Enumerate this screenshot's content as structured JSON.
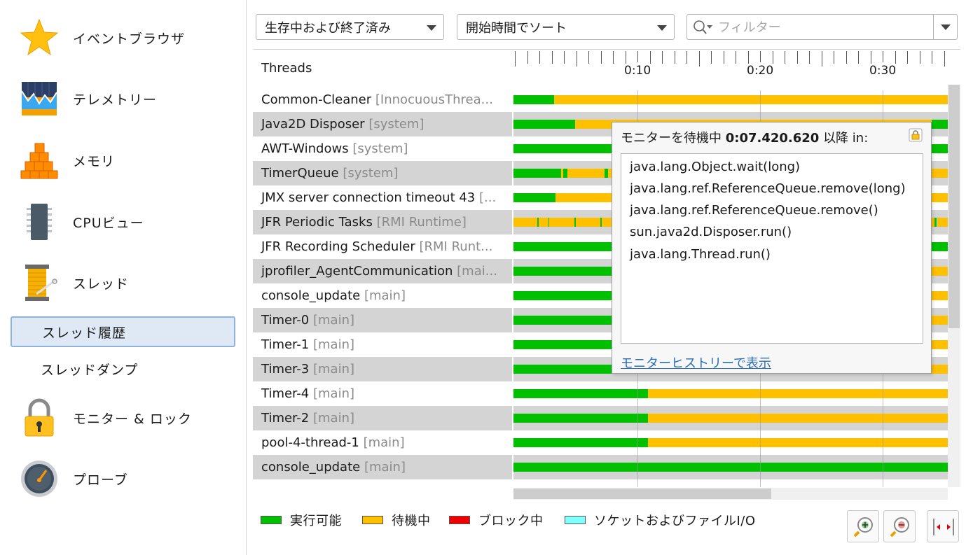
{
  "sidebar": {
    "items": [
      {
        "label": "イベントブラウザ",
        "icon": "star-icon"
      },
      {
        "label": "テレメトリー",
        "icon": "telemetry-icon"
      },
      {
        "label": "メモリ",
        "icon": "memory-blocks-icon"
      },
      {
        "label": "CPUビュー",
        "icon": "cpu-chip-icon"
      },
      {
        "label": "スレッド",
        "icon": "thread-spool-icon"
      },
      {
        "label": "モニター & ロック",
        "icon": "padlock-icon"
      },
      {
        "label": "プローブ",
        "icon": "gauge-icon"
      }
    ],
    "subitems": [
      {
        "label": "スレッド履歴",
        "selected": true
      },
      {
        "label": "スレッドダンプ",
        "selected": false
      }
    ]
  },
  "toolbar": {
    "state_filter": "生存中および終了済み",
    "sort": "開始時間でソート",
    "filter_placeholder": "フィルター"
  },
  "threads": {
    "header": "Threads",
    "time_labels": [
      "0:10",
      "0:20",
      "0:30"
    ],
    "rows": [
      {
        "name": "Common-Cleaner",
        "group": "[InnocuousThrea..."
      },
      {
        "name": "Java2D Disposer",
        "group": "[system]"
      },
      {
        "name": "AWT-Windows",
        "group": "[system]"
      },
      {
        "name": "TimerQueue",
        "group": "[system]"
      },
      {
        "name": "JMX server connection timeout 43",
        "group": "[..."
      },
      {
        "name": "JFR Periodic Tasks",
        "group": "[RMI Runtime]"
      },
      {
        "name": "JFR Recording Scheduler",
        "group": "[RMI Runt..."
      },
      {
        "name": "jprofiler_AgentCommunication",
        "group": "[mai..."
      },
      {
        "name": "console_update",
        "group": "[main]"
      },
      {
        "name": "Timer-0",
        "group": "[main]"
      },
      {
        "name": "Timer-1",
        "group": "[main]"
      },
      {
        "name": "Timer-3",
        "group": "[main]"
      },
      {
        "name": "Timer-4",
        "group": "[main]"
      },
      {
        "name": "Timer-2",
        "group": "[main]"
      },
      {
        "name": "pool-4-thread-1",
        "group": "[main]"
      },
      {
        "name": "console_update",
        "group": "[main]"
      }
    ]
  },
  "popup": {
    "title_prefix": "モニターを待機中",
    "time": "0:07.420.620",
    "title_suffix": "以降 in:",
    "stack": [
      "java.lang.Object.wait(long)",
      "java.lang.ref.ReferenceQueue.remove(long)",
      "java.lang.ref.ReferenceQueue.remove()",
      "sun.java2d.Disposer.run()",
      "java.lang.Thread.run()"
    ],
    "link": "モニターヒストリーで表示"
  },
  "legend": [
    {
      "label": "実行可能",
      "color": "#00c000"
    },
    {
      "label": "待機中",
      "color": "#ffc000"
    },
    {
      "label": "ブロック中",
      "color": "#ee0000"
    },
    {
      "label": "ソケットおよびファイルI/O",
      "color": "#80ffff"
    }
  ],
  "colors": {
    "runnable": "#00c000",
    "waiting": "#ffc000",
    "selected_bg": "#dfe9f5",
    "selected_border": "#8fb4da",
    "alt_row": "#d4d4d4",
    "link": "#2a6ebc"
  },
  "zoom_buttons": [
    {
      "icon": "zoom-in-icon"
    },
    {
      "icon": "zoom-out-icon"
    },
    {
      "icon": "fit-width-icon"
    }
  ]
}
